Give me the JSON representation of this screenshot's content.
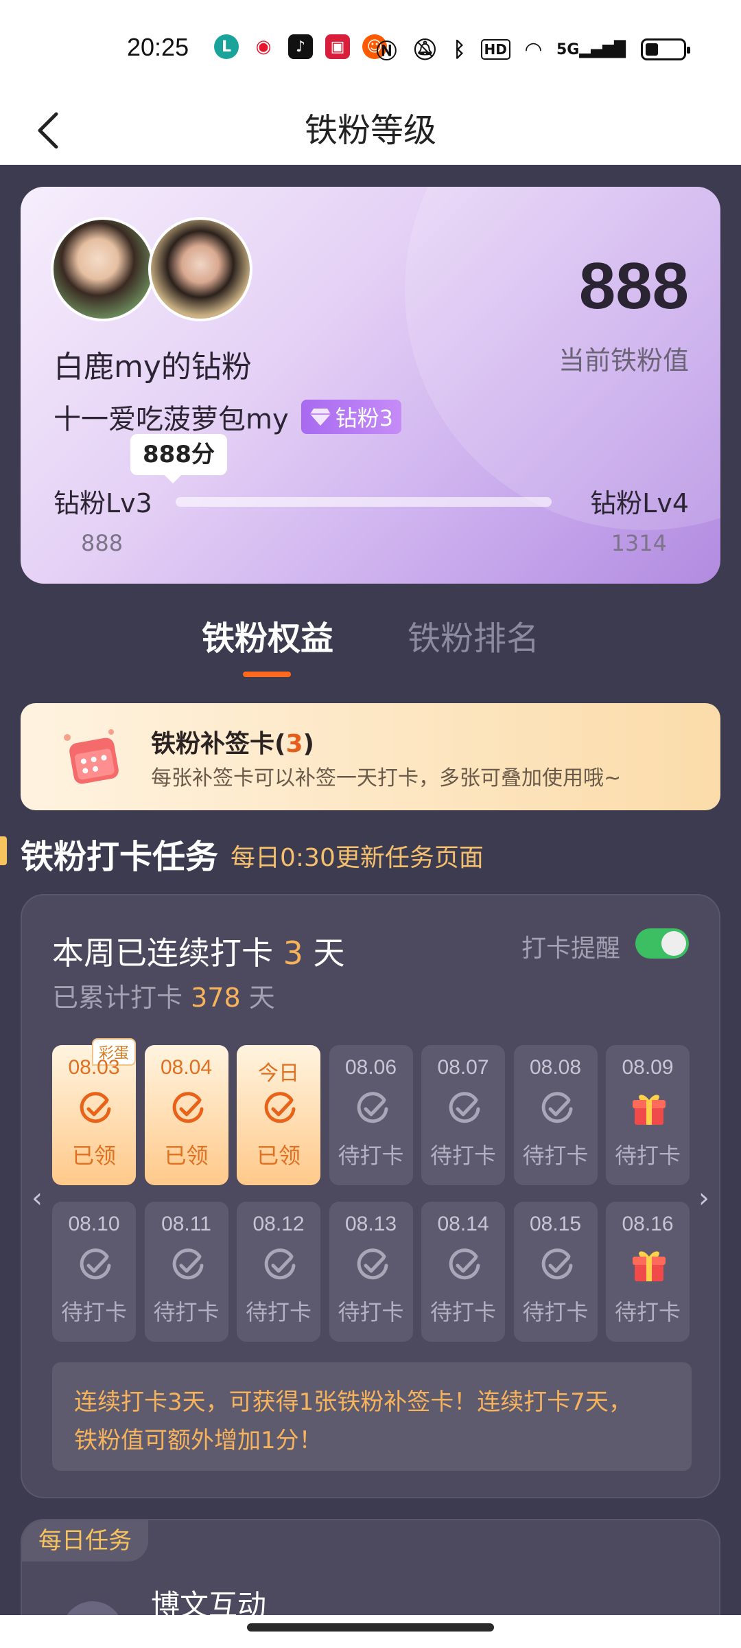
{
  "status_bar": {
    "time": "20:25",
    "app_icons": [
      "green-app-icon",
      "weibo-icon",
      "tiktok-icon",
      "store-icon",
      "taobao-icon"
    ],
    "right_icons": [
      "nfc-icon",
      "mute-icon",
      "bluetooth-icon",
      "hd-icon",
      "wifi-icon",
      "signal-5g-icon",
      "battery-icon"
    ],
    "hd_text": "HD",
    "net_text": "5G"
  },
  "nav": {
    "title": "铁粉等级"
  },
  "profile": {
    "fan_name": "白鹿my的钻粉",
    "user_name": "十一爱吃菠萝包my",
    "badge": "钻粉3",
    "score": "888",
    "score_label": "当前铁粉值",
    "tooltip": "888分",
    "level_from": "钻粉Lv3",
    "level_to": "钻粉Lv4",
    "value_from": "888",
    "value_to": "1314",
    "progress": 0
  },
  "tabs": {
    "active": "铁粉权益",
    "inactive": "铁粉排名"
  },
  "supplement": {
    "title": "铁粉补签卡(",
    "count": "3",
    "title_end": ")",
    "desc": "每张补签卡可以补签一天打卡，多张可叠加使用哦~"
  },
  "section": {
    "title": "铁粉打卡任务",
    "subtitle": "每日0:30更新任务页面"
  },
  "checkin": {
    "streak_prefix": "本周已连续打卡 ",
    "streak_days": "3",
    "streak_suffix": " 天",
    "total_prefix": "已累计打卡 ",
    "total_days": "378",
    "total_suffix": " 天",
    "remind_label": "打卡提醒",
    "remind_on": true,
    "egg_tag": "彩蛋",
    "days": [
      {
        "date": "08.03",
        "status": "已领",
        "done": true,
        "gift": false
      },
      {
        "date": "08.04",
        "status": "已领",
        "done": true,
        "gift": false
      },
      {
        "date": "今日",
        "status": "已领",
        "done": true,
        "gift": false
      },
      {
        "date": "08.06",
        "status": "待打卡",
        "done": false,
        "gift": false
      },
      {
        "date": "08.07",
        "status": "待打卡",
        "done": false,
        "gift": false
      },
      {
        "date": "08.08",
        "status": "待打卡",
        "done": false,
        "gift": false
      },
      {
        "date": "08.09",
        "status": "待打卡",
        "done": false,
        "gift": true
      },
      {
        "date": "08.10",
        "status": "待打卡",
        "done": false,
        "gift": false
      },
      {
        "date": "08.11",
        "status": "待打卡",
        "done": false,
        "gift": false
      },
      {
        "date": "08.12",
        "status": "待打卡",
        "done": false,
        "gift": false
      },
      {
        "date": "08.13",
        "status": "待打卡",
        "done": false,
        "gift": false
      },
      {
        "date": "08.14",
        "status": "待打卡",
        "done": false,
        "gift": false
      },
      {
        "date": "08.15",
        "status": "待打卡",
        "done": false,
        "gift": false
      },
      {
        "date": "08.16",
        "status": "待打卡",
        "done": false,
        "gift": true
      }
    ],
    "hint_line1": "连续打卡3天，可获得1张铁粉补签卡！连续打卡7天，",
    "hint_line2": "铁粉值可额外增加1分！"
  },
  "daily": {
    "tag": "每日任务",
    "item_title": "博文互动"
  },
  "colors": {
    "accent_orange": "#ff6a1f",
    "gold": "#f6b35c",
    "toggle_green": "#3bbf62",
    "bg": "#3d3b4f"
  }
}
